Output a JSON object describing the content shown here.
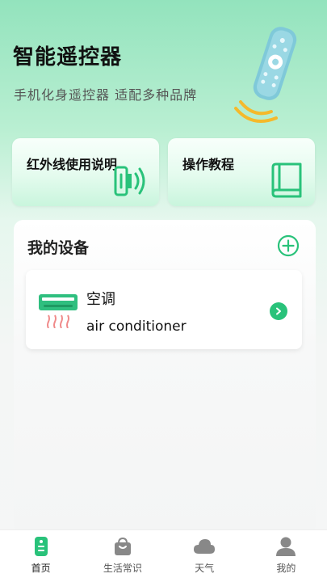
{
  "header": {
    "title": "智能遥控器",
    "subtitle": "手机化身遥控器 适配多种品牌"
  },
  "quick_cards": [
    {
      "label": "红外线使用说明",
      "icon": "infrared-phone-icon"
    },
    {
      "label": "操作教程",
      "icon": "book-icon"
    }
  ],
  "devices": {
    "title": "我的设备",
    "items": [
      {
        "name": "空调",
        "subtitle": "air conditioner",
        "icon": "air-conditioner-icon"
      }
    ]
  },
  "tabs": [
    {
      "label": "首页",
      "icon": "remote-icon",
      "active": true
    },
    {
      "label": "生活常识",
      "icon": "shopping-bag-icon",
      "active": false
    },
    {
      "label": "天气",
      "icon": "cloud-icon",
      "active": false
    },
    {
      "label": "我的",
      "icon": "user-icon",
      "active": false
    }
  ],
  "colors": {
    "accent": "#29c27a",
    "remote_body": "#7fc9d9",
    "signal": "#f5b92b"
  }
}
